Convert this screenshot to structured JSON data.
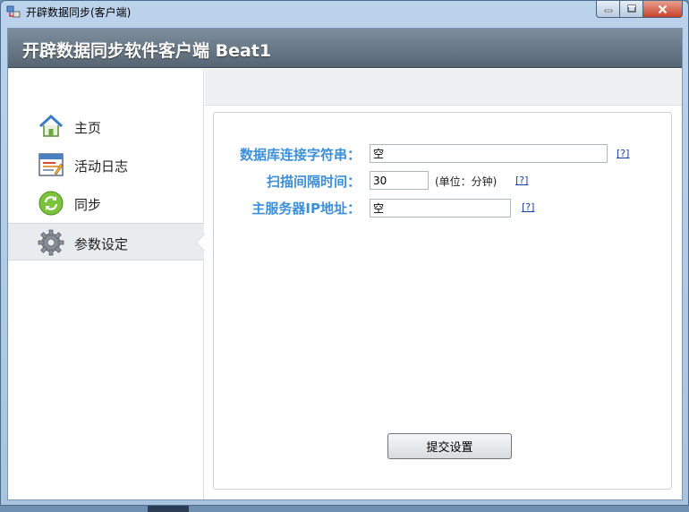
{
  "window": {
    "title": "开辟数据同步(客户端)",
    "controls": {
      "minimize": "–",
      "maximize": "□",
      "close": "✕"
    }
  },
  "header": {
    "app_title": "开辟数据同步软件客户端 Beat1"
  },
  "sidebar": {
    "items": [
      {
        "label": "主页",
        "icon": "home-icon",
        "active": false
      },
      {
        "label": "活动日志",
        "icon": "calendar-log-icon",
        "active": false
      },
      {
        "label": "同步",
        "icon": "sync-icon",
        "active": false
      },
      {
        "label": "参数设定",
        "icon": "gear-icon",
        "active": true
      }
    ]
  },
  "form": {
    "connection_string": {
      "label": "数据库连接字符串：",
      "value": "空",
      "help": "[?]"
    },
    "scan_interval": {
      "label": "扫描间隔时间：",
      "value": "30",
      "unit": "(单位：分钟)",
      "help": "[?]"
    },
    "server_ip": {
      "label": "主服务器IP地址：",
      "value": "空",
      "help": "[?]"
    },
    "submit_label": "提交设置"
  },
  "colors": {
    "label_blue": "#3d8fd8",
    "header_gray": "#5f6e7c",
    "link_blue": "#1b3fa8"
  }
}
